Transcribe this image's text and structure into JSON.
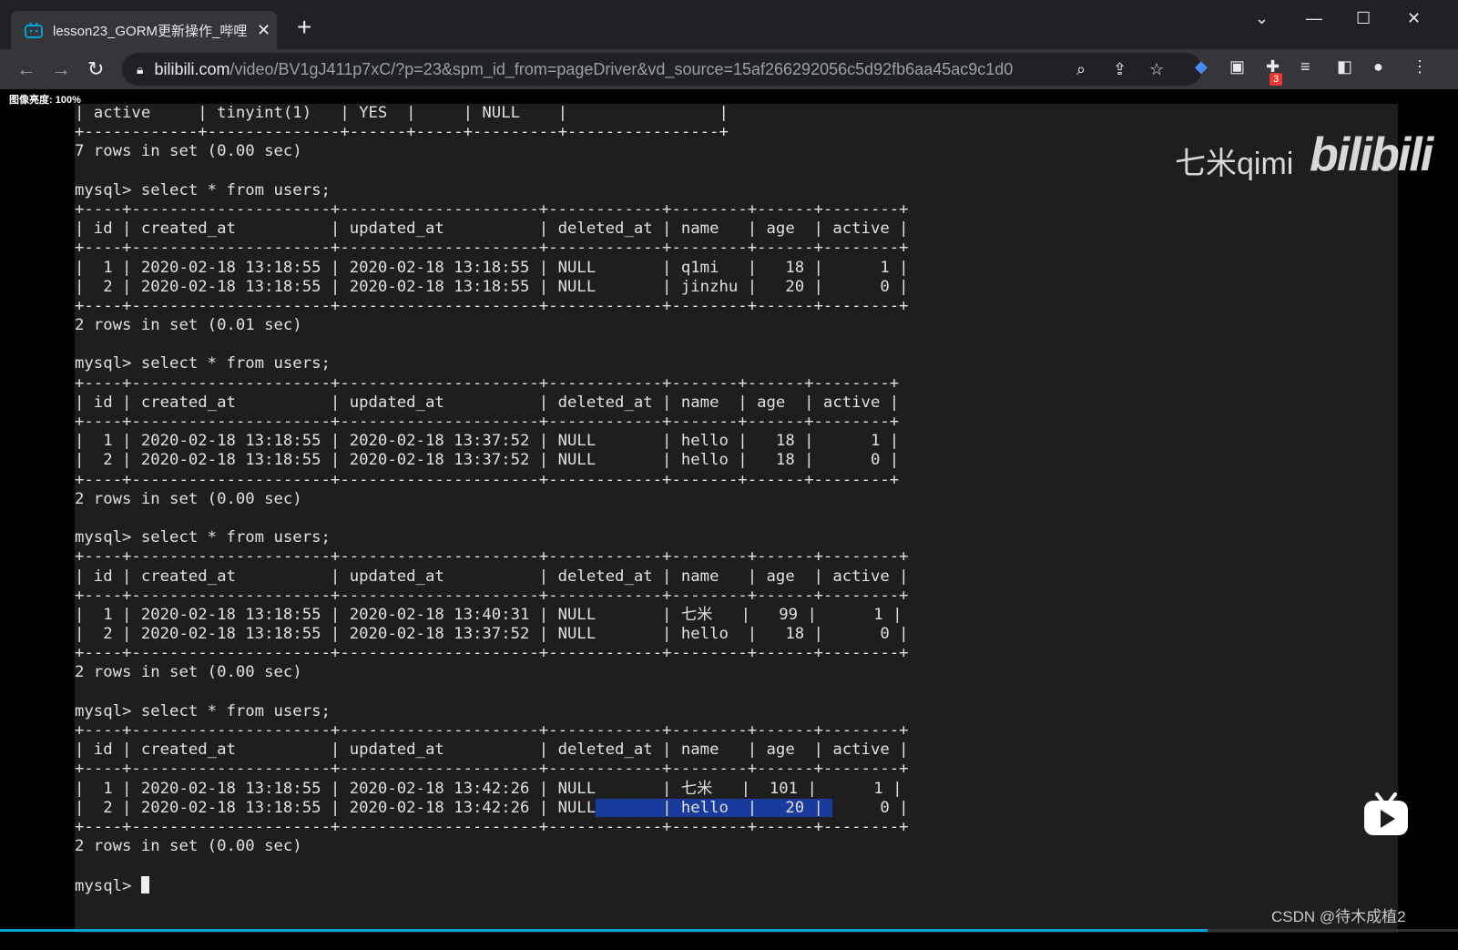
{
  "browser": {
    "tab_title": "lesson23_GORM更新操作_哔哩",
    "tab_close": "✕",
    "new_tab": "+",
    "url_host": "bilibili.com",
    "url_path": "/video/BV1gJ411p7xC/?p=23&spm_id_from=pageDriver&vd_source=15af266292056c5d92fb6aa45ac9c1d0",
    "extension_badge": "3",
    "window_controls": [
      "⌄",
      "—",
      "☐",
      "✕"
    ]
  },
  "overlay": {
    "brightness": "图像亮度: 100%",
    "watermark_text": "七米qimi",
    "watermark_logo": "bilibili",
    "csdn_credit": "CSDN @待木成植2"
  },
  "terminal": {
    "lines": [
      "| active     | tinyint(1)   | YES  |     | NULL    |                |",
      "+------------+--------------+------+-----+---------+----------------+",
      "7 rows in set (0.00 sec)",
      "",
      "mysql> select * from users;",
      "+----+---------------------+---------------------+------------+--------+------+--------+",
      "| id | created_at          | updated_at          | deleted_at | name   | age  | active |",
      "+----+---------------------+---------------------+------------+--------+------+--------+",
      "|  1 | 2020-02-18 13:18:55 | 2020-02-18 13:18:55 | NULL       | q1mi   |   18 |      1 |",
      "|  2 | 2020-02-18 13:18:55 | 2020-02-18 13:18:55 | NULL       | jinzhu |   20 |      0 |",
      "+----+---------------------+---------------------+------------+--------+------+--------+",
      "2 rows in set (0.01 sec)",
      "",
      "mysql> select * from users;",
      "+----+---------------------+---------------------+------------+-------+------+--------+",
      "| id | created_at          | updated_at          | deleted_at | name  | age  | active |",
      "+----+---------------------+---------------------+------------+-------+------+--------+",
      "|  1 | 2020-02-18 13:18:55 | 2020-02-18 13:37:52 | NULL       | hello |   18 |      1 |",
      "|  2 | 2020-02-18 13:18:55 | 2020-02-18 13:37:52 | NULL       | hello |   18 |      0 |",
      "+----+---------------------+---------------------+------------+-------+------+--------+",
      "2 rows in set (0.00 sec)",
      "",
      "mysql> select * from users;",
      "+----+---------------------+---------------------+------------+--------+------+--------+",
      "| id | created_at          | updated_at          | deleted_at | name   | age  | active |",
      "+----+---------------------+---------------------+------------+--------+------+--------+",
      "|  1 | 2020-02-18 13:18:55 | 2020-02-18 13:40:31 | NULL       | 七米   |   99 |      1 |",
      "|  2 | 2020-02-18 13:18:55 | 2020-02-18 13:37:52 | NULL       | hello  |   18 |      0 |",
      "+----+---------------------+---------------------+------------+--------+------+--------+",
      "2 rows in set (0.00 sec)",
      "",
      "mysql> select * from users;",
      "+----+---------------------+---------------------+------------+--------+------+--------+",
      "| id | created_at          | updated_at          | deleted_at | name   | age  | active |",
      "+----+---------------------+---------------------+------------+--------+------+--------+",
      "|  1 | 2020-02-18 13:18:55 | 2020-02-18 13:42:26 | NULL       | 七米   |  101 |      1 |",
      "|  2 | 2020-02-18 13:18:55 | 2020-02-18 13:42:26 | NULL       | hello  |   20 |      0 |",
      "+----+---------------------+---------------------+------------+--------+------+--------+",
      "2 rows in set (0.00 sec)",
      "",
      "mysql> "
    ]
  }
}
